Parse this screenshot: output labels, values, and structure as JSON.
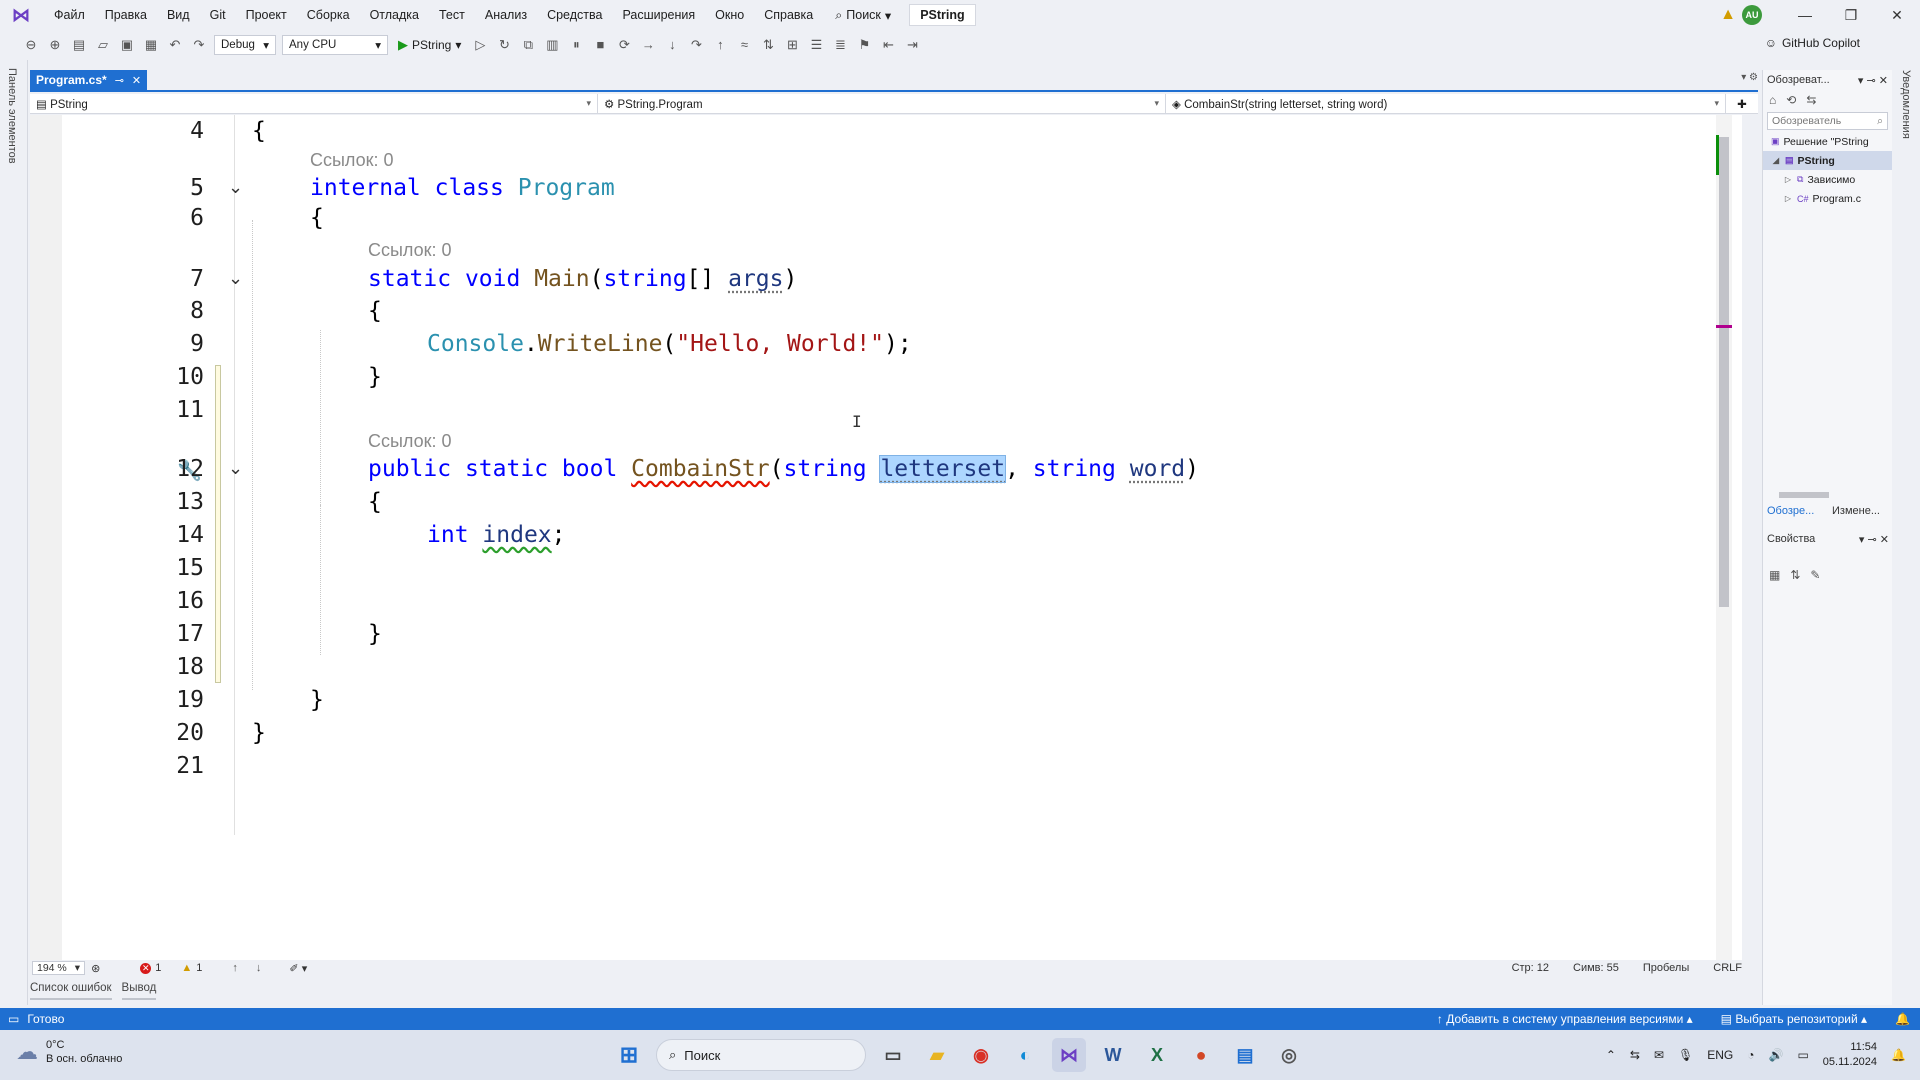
{
  "menubar": {
    "logo": "VS",
    "items": [
      "Файл",
      "Правка",
      "Вид",
      "Git",
      "Проект",
      "Сборка",
      "Отладка",
      "Тест",
      "Анализ",
      "Средства",
      "Расширения",
      "Окно",
      "Справка"
    ],
    "search_label": "Поиск",
    "project_name": "PString",
    "user_initials": "AU"
  },
  "toolbar": {
    "configuration": "Debug",
    "platform": "Any CPU",
    "run_label": "PString",
    "copilot_label": "GitHub Copilot"
  },
  "left_strip_label": "Панель элементов",
  "right_strip_label": "Уведомления",
  "document_tab": {
    "label": "Program.cs*"
  },
  "navbar": {
    "project": "PString",
    "class": "PString.Program",
    "member": "CombainStr(string letterset, string word)"
  },
  "code": {
    "refs_label": "Ссылок: 0",
    "lines": [
      {
        "num": "4"
      },
      {
        "num": "5"
      },
      {
        "num": "6"
      },
      {
        "num": "7"
      },
      {
        "num": "8"
      },
      {
        "num": "9"
      },
      {
        "num": "10"
      },
      {
        "num": "11"
      },
      {
        "num": "12"
      },
      {
        "num": "13"
      },
      {
        "num": "14"
      },
      {
        "num": "15"
      },
      {
        "num": "16"
      },
      {
        "num": "17"
      },
      {
        "num": "18"
      },
      {
        "num": "19"
      },
      {
        "num": "20"
      },
      {
        "num": "21"
      }
    ],
    "tokens": {
      "brace_open": "{",
      "brace_close": "}",
      "internal": "internal",
      "class": "class",
      "program": "Program",
      "static": "static",
      "void": "void",
      "main": "Main",
      "string": "string",
      "brackets": "[]",
      "args": "args",
      "paren_open": "(",
      "paren_close": ")",
      "console": "Console",
      "dot": ".",
      "writeline": "WriteLine",
      "hello": "\"Hello, World!\"",
      "close_semi": ");",
      "public": "public",
      "bool": "bool",
      "combain": "CombainStr",
      "letterset": "letterset",
      "comma": ",",
      "word": "word",
      "int": "int",
      "index": "index",
      "semi": ";"
    }
  },
  "editor_status": {
    "zoom": "194 %",
    "errors": "1",
    "warnings": "1",
    "line": "Стр: 12",
    "char": "Симв: 55",
    "spaces": "Пробелы",
    "eol": "CRLF"
  },
  "bottom_tabs": [
    "Список ошибок",
    "Вывод"
  ],
  "right_panel": {
    "title": "Обозреват...",
    "search_placeholder": "Обозреватель",
    "tree": {
      "solution": "Решение \"PString",
      "project": "PString",
      "deps": "Зависимо",
      "file": "Program.c"
    },
    "tab_explorer": "Обозре...",
    "tab_changes": "Измене...",
    "props_title": "Свойства"
  },
  "vs_status": {
    "ready": "Готово",
    "add_vcs": "Добавить в систему управления версиями",
    "select_repo": "Выбрать репозиторий"
  },
  "taskbar": {
    "temperature": "0°C",
    "weather": "В осн. облачно",
    "search": "Поиск",
    "lang": "ENG",
    "time": "11:54",
    "date": "05.11.2024"
  }
}
